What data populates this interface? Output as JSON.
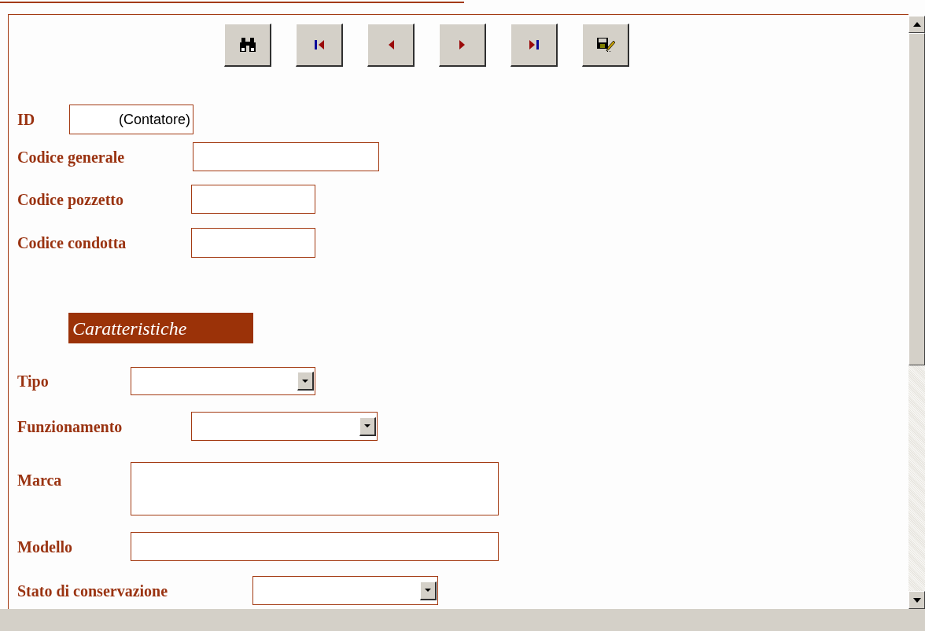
{
  "toolbar_buttons": [
    {
      "kind": "find"
    },
    {
      "kind": "first"
    },
    {
      "kind": "previous"
    },
    {
      "kind": "next"
    },
    {
      "kind": "last"
    },
    {
      "kind": "save"
    }
  ],
  "fields": [
    {
      "kind": "text",
      "label": "ID",
      "value": "(Contatore)"
    },
    {
      "kind": "text",
      "label": "Codice generale"
    },
    {
      "kind": "text",
      "label": "Codice pozzetto"
    },
    {
      "kind": "text",
      "label": "Codice condotta"
    },
    {
      "kind": "heading",
      "label": "Caratteristiche"
    },
    {
      "kind": "combo",
      "label": "Tipo"
    },
    {
      "kind": "combo",
      "label": "Funzionamento"
    },
    {
      "kind": "memo",
      "label": "Marca"
    },
    {
      "kind": "text",
      "label": "Modello"
    },
    {
      "kind": "combo",
      "label": "Stato di conservazione"
    }
  ]
}
